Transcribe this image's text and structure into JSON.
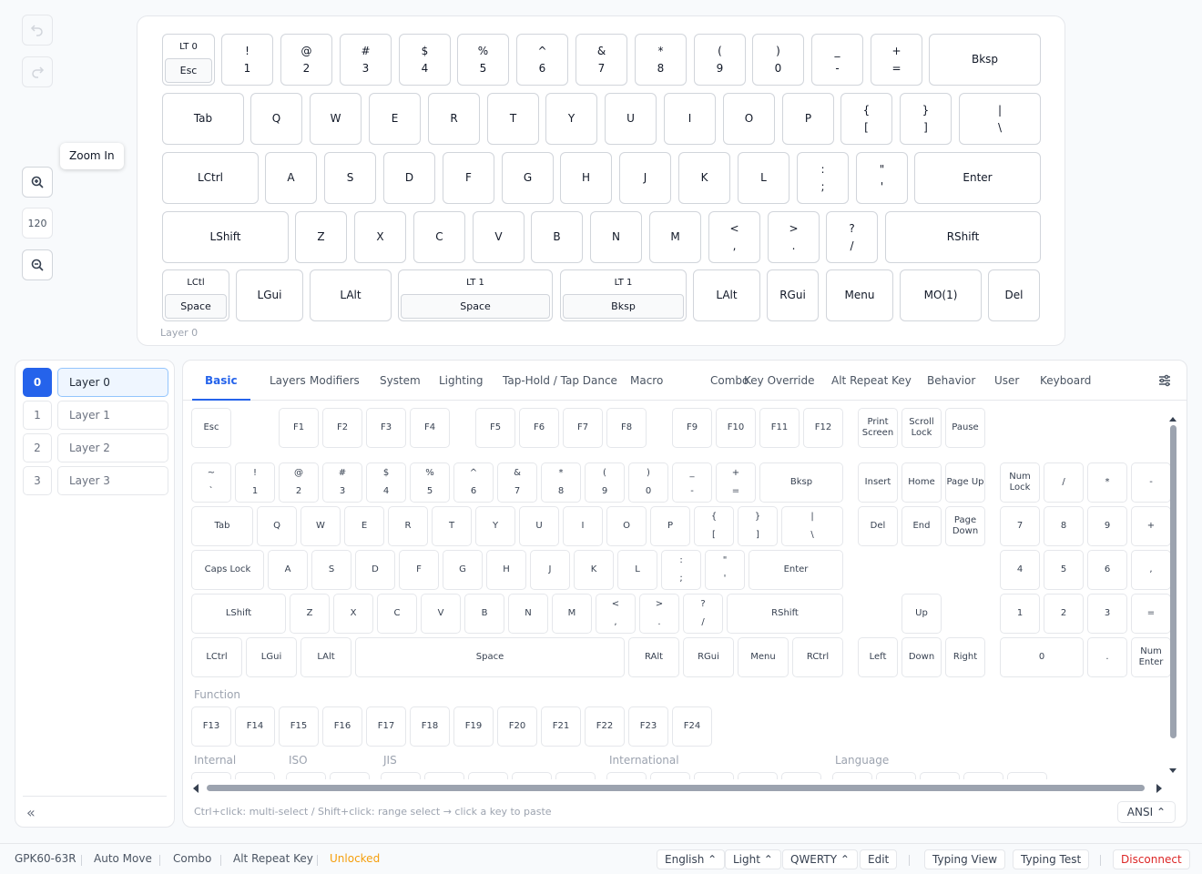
{
  "toolbar": {
    "zoom_value": "120",
    "tooltip": "Zoom In"
  },
  "keyboard": {
    "layer_label": "Layer 0",
    "rows": [
      [
        {
          "lt": "LT 0",
          "in": "Esc"
        },
        {
          "t": "!",
          "b": "1"
        },
        {
          "t": "@",
          "b": "2"
        },
        {
          "t": "#",
          "b": "3"
        },
        {
          "t": "$",
          "b": "4"
        },
        {
          "t": "%",
          "b": "5"
        },
        {
          "t": "^",
          "b": "6"
        },
        {
          "t": "&",
          "b": "7"
        },
        {
          "t": "*",
          "b": "8"
        },
        {
          "t": "(",
          "b": "9"
        },
        {
          "t": ")",
          "b": "0"
        },
        {
          "t": "_",
          "b": "-"
        },
        {
          "t": "+",
          "b": "="
        },
        {
          "l": "Bksp"
        }
      ],
      [
        {
          "l": "Tab"
        },
        {
          "l": "Q"
        },
        {
          "l": "W"
        },
        {
          "l": "E"
        },
        {
          "l": "R"
        },
        {
          "l": "T"
        },
        {
          "l": "Y"
        },
        {
          "l": "U"
        },
        {
          "l": "I"
        },
        {
          "l": "O"
        },
        {
          "l": "P"
        },
        {
          "t": "{",
          "b": "["
        },
        {
          "t": "}",
          "b": "]"
        },
        {
          "t": "|",
          "b": "\\"
        }
      ],
      [
        {
          "l": "LCtrl"
        },
        {
          "l": "A"
        },
        {
          "l": "S"
        },
        {
          "l": "D"
        },
        {
          "l": "F"
        },
        {
          "l": "G"
        },
        {
          "l": "H"
        },
        {
          "l": "J"
        },
        {
          "l": "K"
        },
        {
          "l": "L"
        },
        {
          "t": ":",
          "b": ";"
        },
        {
          "t": "\"",
          "b": "'"
        },
        {
          "l": "Enter"
        }
      ],
      [
        {
          "l": "LShift"
        },
        {
          "l": "Z"
        },
        {
          "l": "X"
        },
        {
          "l": "C"
        },
        {
          "l": "V"
        },
        {
          "l": "B"
        },
        {
          "l": "N"
        },
        {
          "l": "M"
        },
        {
          "t": "<",
          "b": ","
        },
        {
          "t": ">",
          "b": "."
        },
        {
          "t": "?",
          "b": "/"
        },
        {
          "l": "RShift"
        }
      ],
      [
        {
          "lt": "LCtl",
          "in": "Space"
        },
        {
          "l": "LGui"
        },
        {
          "l": "LAlt"
        },
        {
          "lt": "LT 1",
          "in": "Space"
        },
        {
          "lt": "LT 1",
          "in": "Bksp"
        },
        {
          "l": "LAlt"
        },
        {
          "l": "RGui"
        },
        {
          "l": "Menu"
        },
        {
          "l": "MO(1)"
        },
        {
          "l": "Del"
        }
      ]
    ]
  },
  "layers": [
    {
      "num": "0",
      "name": "Layer 0",
      "active": true
    },
    {
      "num": "1",
      "name": "Layer 1"
    },
    {
      "num": "2",
      "name": "Layer 2"
    },
    {
      "num": "3",
      "name": "Layer 3"
    }
  ],
  "layers_collapse": "«",
  "tabs": [
    "Basic",
    "Layers",
    "Modifiers",
    "System",
    "Lighting",
    "Tap-Hold / Tap Dance",
    "Macro",
    "Combo",
    "Key Override",
    "Alt Repeat Key",
    "Behavior",
    "User",
    "Keyboard"
  ],
  "palette": {
    "frow": [
      "Esc",
      "F1",
      "F2",
      "F3",
      "F4",
      "F5",
      "F6",
      "F7",
      "F8",
      "F9",
      "F10",
      "F11",
      "F12",
      "Print Screen",
      "Scroll Lock",
      "Pause"
    ],
    "num_row": [
      [
        "~",
        "`"
      ],
      [
        "!",
        "1"
      ],
      [
        "@",
        "2"
      ],
      [
        "#",
        "3"
      ],
      [
        "$",
        "4"
      ],
      [
        "%",
        "5"
      ],
      [
        "^",
        "6"
      ],
      [
        "&",
        "7"
      ],
      [
        "*",
        "8"
      ],
      [
        "(",
        "9"
      ],
      [
        ")",
        "0"
      ],
      [
        "_",
        "-"
      ],
      [
        "+",
        "="
      ],
      "Bksp"
    ],
    "qrow": [
      "Tab",
      "Q",
      "W",
      "E",
      "R",
      "T",
      "Y",
      "U",
      "I",
      "O",
      "P",
      [
        "{",
        "["
      ],
      [
        "}",
        "]"
      ],
      [
        "|",
        "\\"
      ]
    ],
    "arow": [
      "Caps Lock",
      "A",
      "S",
      "D",
      "F",
      "G",
      "H",
      "J",
      "K",
      "L",
      [
        ":",
        ";"
      ],
      [
        "\"",
        "'"
      ],
      "Enter"
    ],
    "zrow": [
      "LShift",
      "Z",
      "X",
      "C",
      "V",
      "B",
      "N",
      "M",
      [
        "<",
        ","
      ],
      [
        ">",
        "."
      ],
      [
        "?",
        "/"
      ],
      "RShift"
    ],
    "brow": [
      "LCtrl",
      "LGui",
      "LAlt",
      "Space",
      "RAlt",
      "RGui",
      "Menu",
      "RCtrl"
    ],
    "nav": [
      "Insert",
      "Home",
      "Page Up",
      "Del",
      "End",
      "Page Down",
      "Up",
      "Left",
      "Down",
      "Right"
    ],
    "numpad": [
      "Num Lock",
      "/",
      "*",
      "-",
      "7",
      "8",
      "9",
      "+",
      "4",
      "5",
      "6",
      ",",
      "1",
      "2",
      "3",
      "=",
      "0",
      ".",
      "Num Enter"
    ],
    "function_label": "Function",
    "function_keys": [
      "F13",
      "F14",
      "F15",
      "F16",
      "F17",
      "F18",
      "F19",
      "F20",
      "F21",
      "F22",
      "F23",
      "F24"
    ],
    "sections": [
      "Internal",
      "ISO",
      "JIS",
      "International",
      "Language"
    ]
  },
  "hint": "Ctrl+click: multi-select / Shift+click: range select → click a key to paste",
  "layout_select": "ANSI ⌃",
  "status": {
    "device": "GPK60-63R",
    "items": [
      "Auto Move",
      "Combo",
      "Alt Repeat Key"
    ],
    "lock": "Unlocked",
    "lock_color": "#f59e0b",
    "language": "English ⌃",
    "theme": "Light ⌃",
    "layout": "QWERTY ⌃",
    "edit": "Edit",
    "typing_view": "Typing View",
    "typing_test": "Typing Test",
    "disconnect": "Disconnect"
  }
}
